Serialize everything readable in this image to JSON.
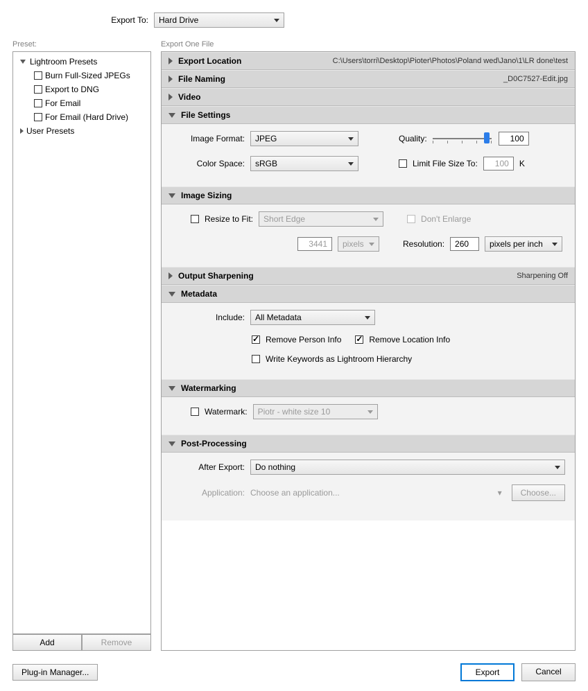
{
  "top": {
    "export_to_label": "Export To:",
    "export_to_value": "Hard Drive"
  },
  "preset_col": {
    "label": "Preset:",
    "groups": [
      {
        "name": "Lightroom Presets",
        "expanded": true,
        "children": [
          {
            "name": "Burn Full-Sized JPEGs",
            "checked": false
          },
          {
            "name": "Export to DNG",
            "checked": false
          },
          {
            "name": "For Email",
            "checked": false
          },
          {
            "name": "For Email (Hard Drive)",
            "checked": false
          }
        ]
      },
      {
        "name": "User Presets",
        "expanded": false
      }
    ],
    "add_btn": "Add",
    "remove_btn": "Remove"
  },
  "export_col": {
    "label": "Export One File",
    "sections": {
      "export_location": {
        "title": "Export Location",
        "aux": "C:\\Users\\torri\\Desktop\\Pioter\\Photos\\Poland wed\\Jano\\1\\LR done\\test"
      },
      "file_naming": {
        "title": "File Naming",
        "aux": "_D0C7527-Edit.jpg"
      },
      "video": {
        "title": "Video"
      },
      "file_settings": {
        "title": "File Settings",
        "image_format_label": "Image Format:",
        "image_format_value": "JPEG",
        "quality_label": "Quality:",
        "quality_value": "100",
        "color_space_label": "Color Space:",
        "color_space_value": "sRGB",
        "limit_label": "Limit File Size To:",
        "limit_value": "100",
        "limit_unit": "K"
      },
      "image_sizing": {
        "title": "Image Sizing",
        "resize_label": "Resize to Fit:",
        "resize_value": "Short Edge",
        "dont_enlarge_label": "Don't Enlarge",
        "dim_value": "3441",
        "dim_unit": "pixels",
        "resolution_label": "Resolution:",
        "resolution_value": "260",
        "resolution_unit": "pixels per inch"
      },
      "output_sharpening": {
        "title": "Output Sharpening",
        "aux": "Sharpening Off"
      },
      "metadata": {
        "title": "Metadata",
        "include_label": "Include:",
        "include_value": "All Metadata",
        "remove_person": "Remove Person Info",
        "remove_location": "Remove Location Info",
        "keywords_label": "Write Keywords as Lightroom Hierarchy"
      },
      "watermarking": {
        "title": "Watermarking",
        "watermark_label": "Watermark:",
        "watermark_value": "Piotr - white size 10"
      },
      "post_processing": {
        "title": "Post-Processing",
        "after_export_label": "After Export:",
        "after_export_value": "Do nothing",
        "application_label": "Application:",
        "application_value": "Choose an application...",
        "choose_btn": "Choose..."
      }
    }
  },
  "footer": {
    "plugin_btn": "Plug-in Manager...",
    "export_btn": "Export",
    "cancel_btn": "Cancel"
  }
}
